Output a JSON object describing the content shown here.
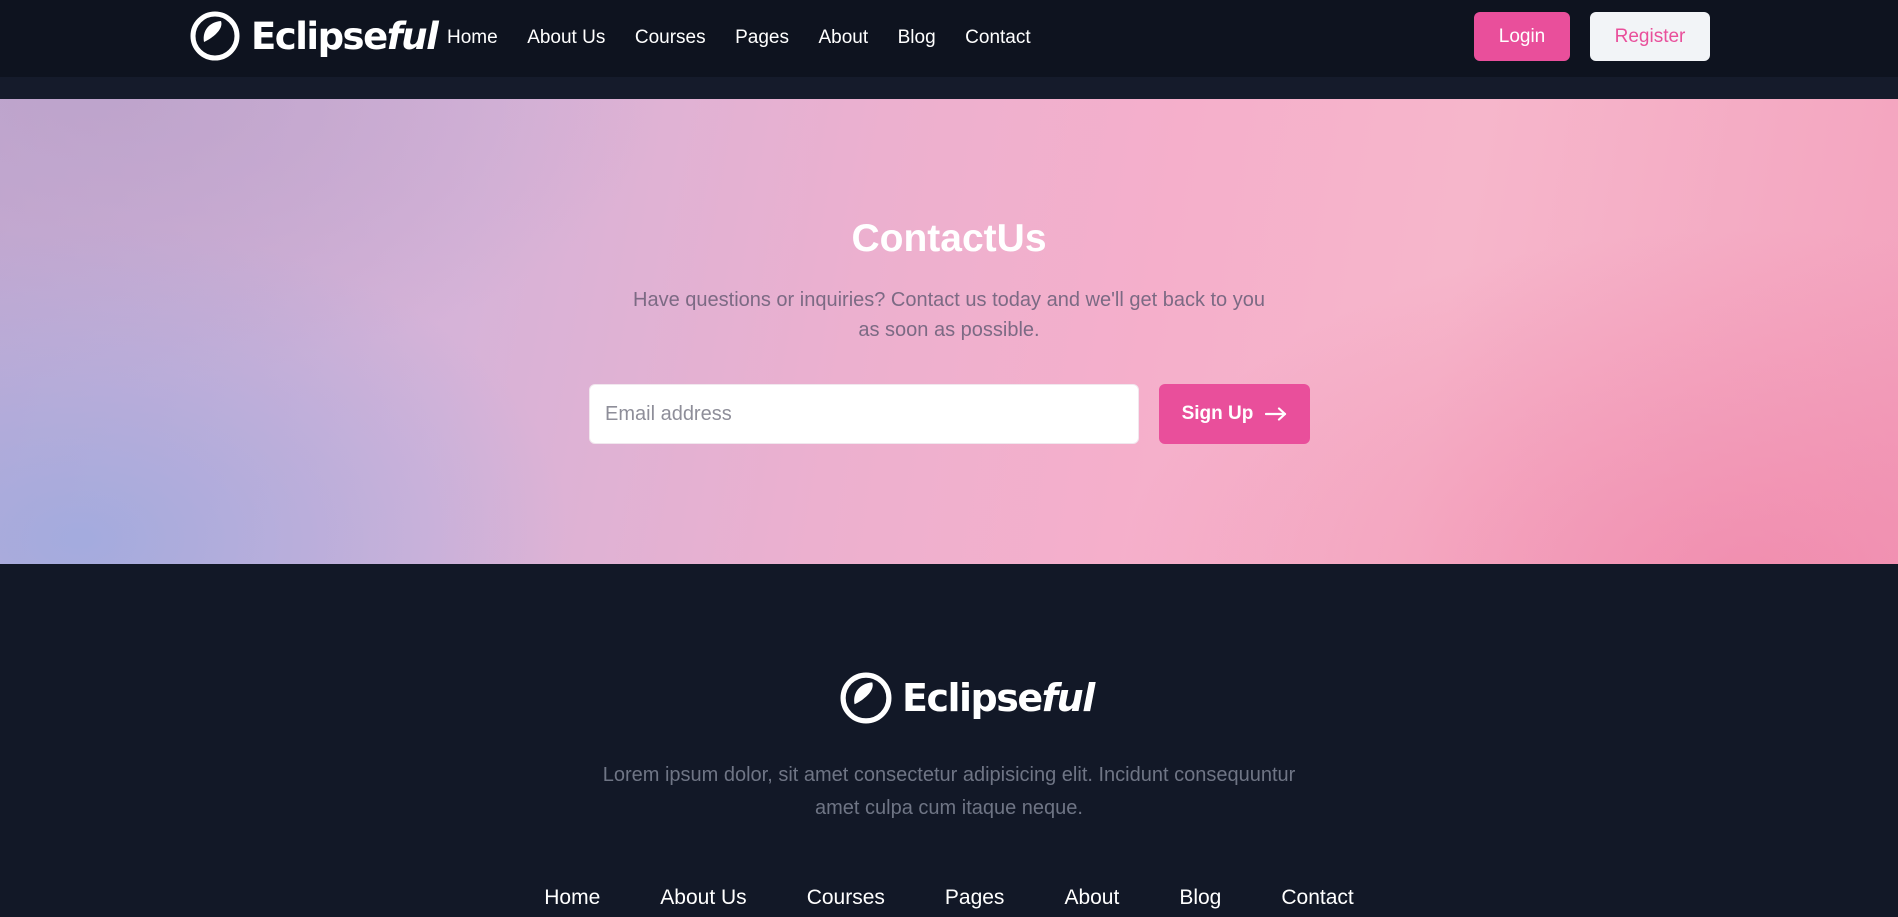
{
  "brand": {
    "name_prefix": "Eclipse",
    "name_suffix": "ful",
    "logo_icon": "eclipse-circle-icon"
  },
  "nav": {
    "links": [
      "Home",
      "About Us",
      "Courses",
      "Pages",
      "About",
      "Blog",
      "Contact"
    ],
    "login_label": "Login",
    "register_label": "Register"
  },
  "hero": {
    "title": "ContactUs",
    "subtitle": "Have questions or inquiries? Contact us today and we'll get back to you as soon as possible.",
    "email_placeholder": "Email address",
    "signup_label": "Sign Up",
    "signup_icon": "arrow-right-icon"
  },
  "footer": {
    "description": "Lorem ipsum dolor, sit amet consectetur adipisicing elit. Incidunt consequuntur amet culpa cum itaque neque.",
    "links": [
      "Home",
      "About Us",
      "Courses",
      "Pages",
      "About",
      "Blog",
      "Contact"
    ]
  },
  "colors": {
    "accent": "#e94f9b",
    "navbar_bg": "#0e131f",
    "footer_bg": "#121827",
    "register_bg": "#f2f4f7"
  }
}
